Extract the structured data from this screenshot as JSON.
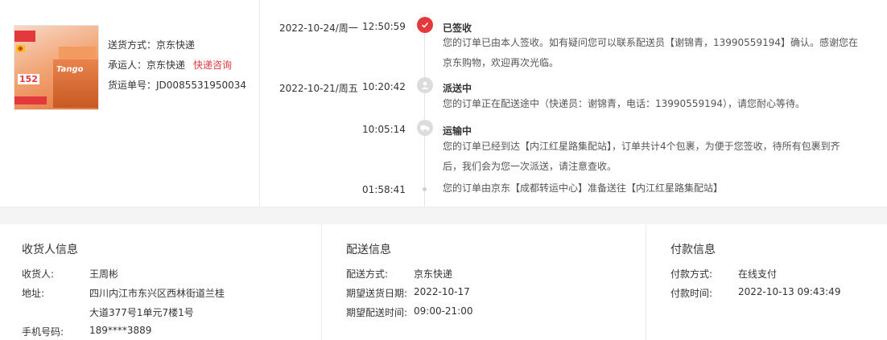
{
  "product": {
    "image_alt": "Tango 复印纸",
    "image_texts": {
      "brand": "Tango",
      "price": "152"
    },
    "delivery_method_label": "送货方式：",
    "delivery_method_value": "京东快递",
    "carrier_label": "承运人：",
    "carrier_value": "京东快递",
    "carrier_link": "快递咨询",
    "tracking_label": "货运单号：",
    "tracking_value": "JD0085531950034"
  },
  "timeline": [
    {
      "date": "2022-10-24/周一",
      "time": "12:50:59",
      "status": "已签收",
      "icon": "check-icon",
      "description": "您的订单已由本人签收。如有疑问您可以联系配送员【谢锦青，13990559194】确认。感谢您在京东购物，欢迎再次光临。"
    },
    {
      "date": "2022-10-21/周五",
      "time": "10:20:42",
      "status": "派送中",
      "icon": "courier-icon",
      "description": "您的订单正在配送途中（快递员：谢锦青，电话：13990559194），请您耐心等待。"
    },
    {
      "date": "",
      "time": "10:05:14",
      "status": "运输中",
      "icon": "truck-icon",
      "description": "您的订单已经到达【内江红星路集配站】，订单共计4个包裹，为便于您签收，待所有包裹到齐后，我们会为您一次派送，请注意查收。"
    },
    {
      "date": "",
      "time": "01:58:41",
      "status": "",
      "icon": "",
      "description": "您的订单由京东【成都转运中心】准备送往【内江红星路集配站】"
    }
  ],
  "receiver": {
    "title": "收货人信息",
    "name_label": "收货人:",
    "name_value": "王周彬",
    "address_label": "地址:",
    "address_line1": "四川内江市东兴区西林街道兰桂",
    "address_line2": "大道377号1单元7楼1号",
    "phone_label": "手机号码:",
    "phone_value": "189****3889"
  },
  "delivery": {
    "title": "配送信息",
    "method_label": "配送方式:",
    "method_value": "京东快递",
    "date_label": "期望送货日期:",
    "date_value": "2022-10-17",
    "time_label": "期望配送时间:",
    "time_value": "09:00-21:00"
  },
  "payment": {
    "title": "付款信息",
    "method_label": "付款方式:",
    "method_value": "在线支付",
    "time_label": "付款时间:",
    "time_value": "2022-10-13 09:43:49"
  },
  "colors": {
    "accent": "#e4393c",
    "text": "#333333",
    "muted": "#555555",
    "divider": "#f4f4f4"
  }
}
